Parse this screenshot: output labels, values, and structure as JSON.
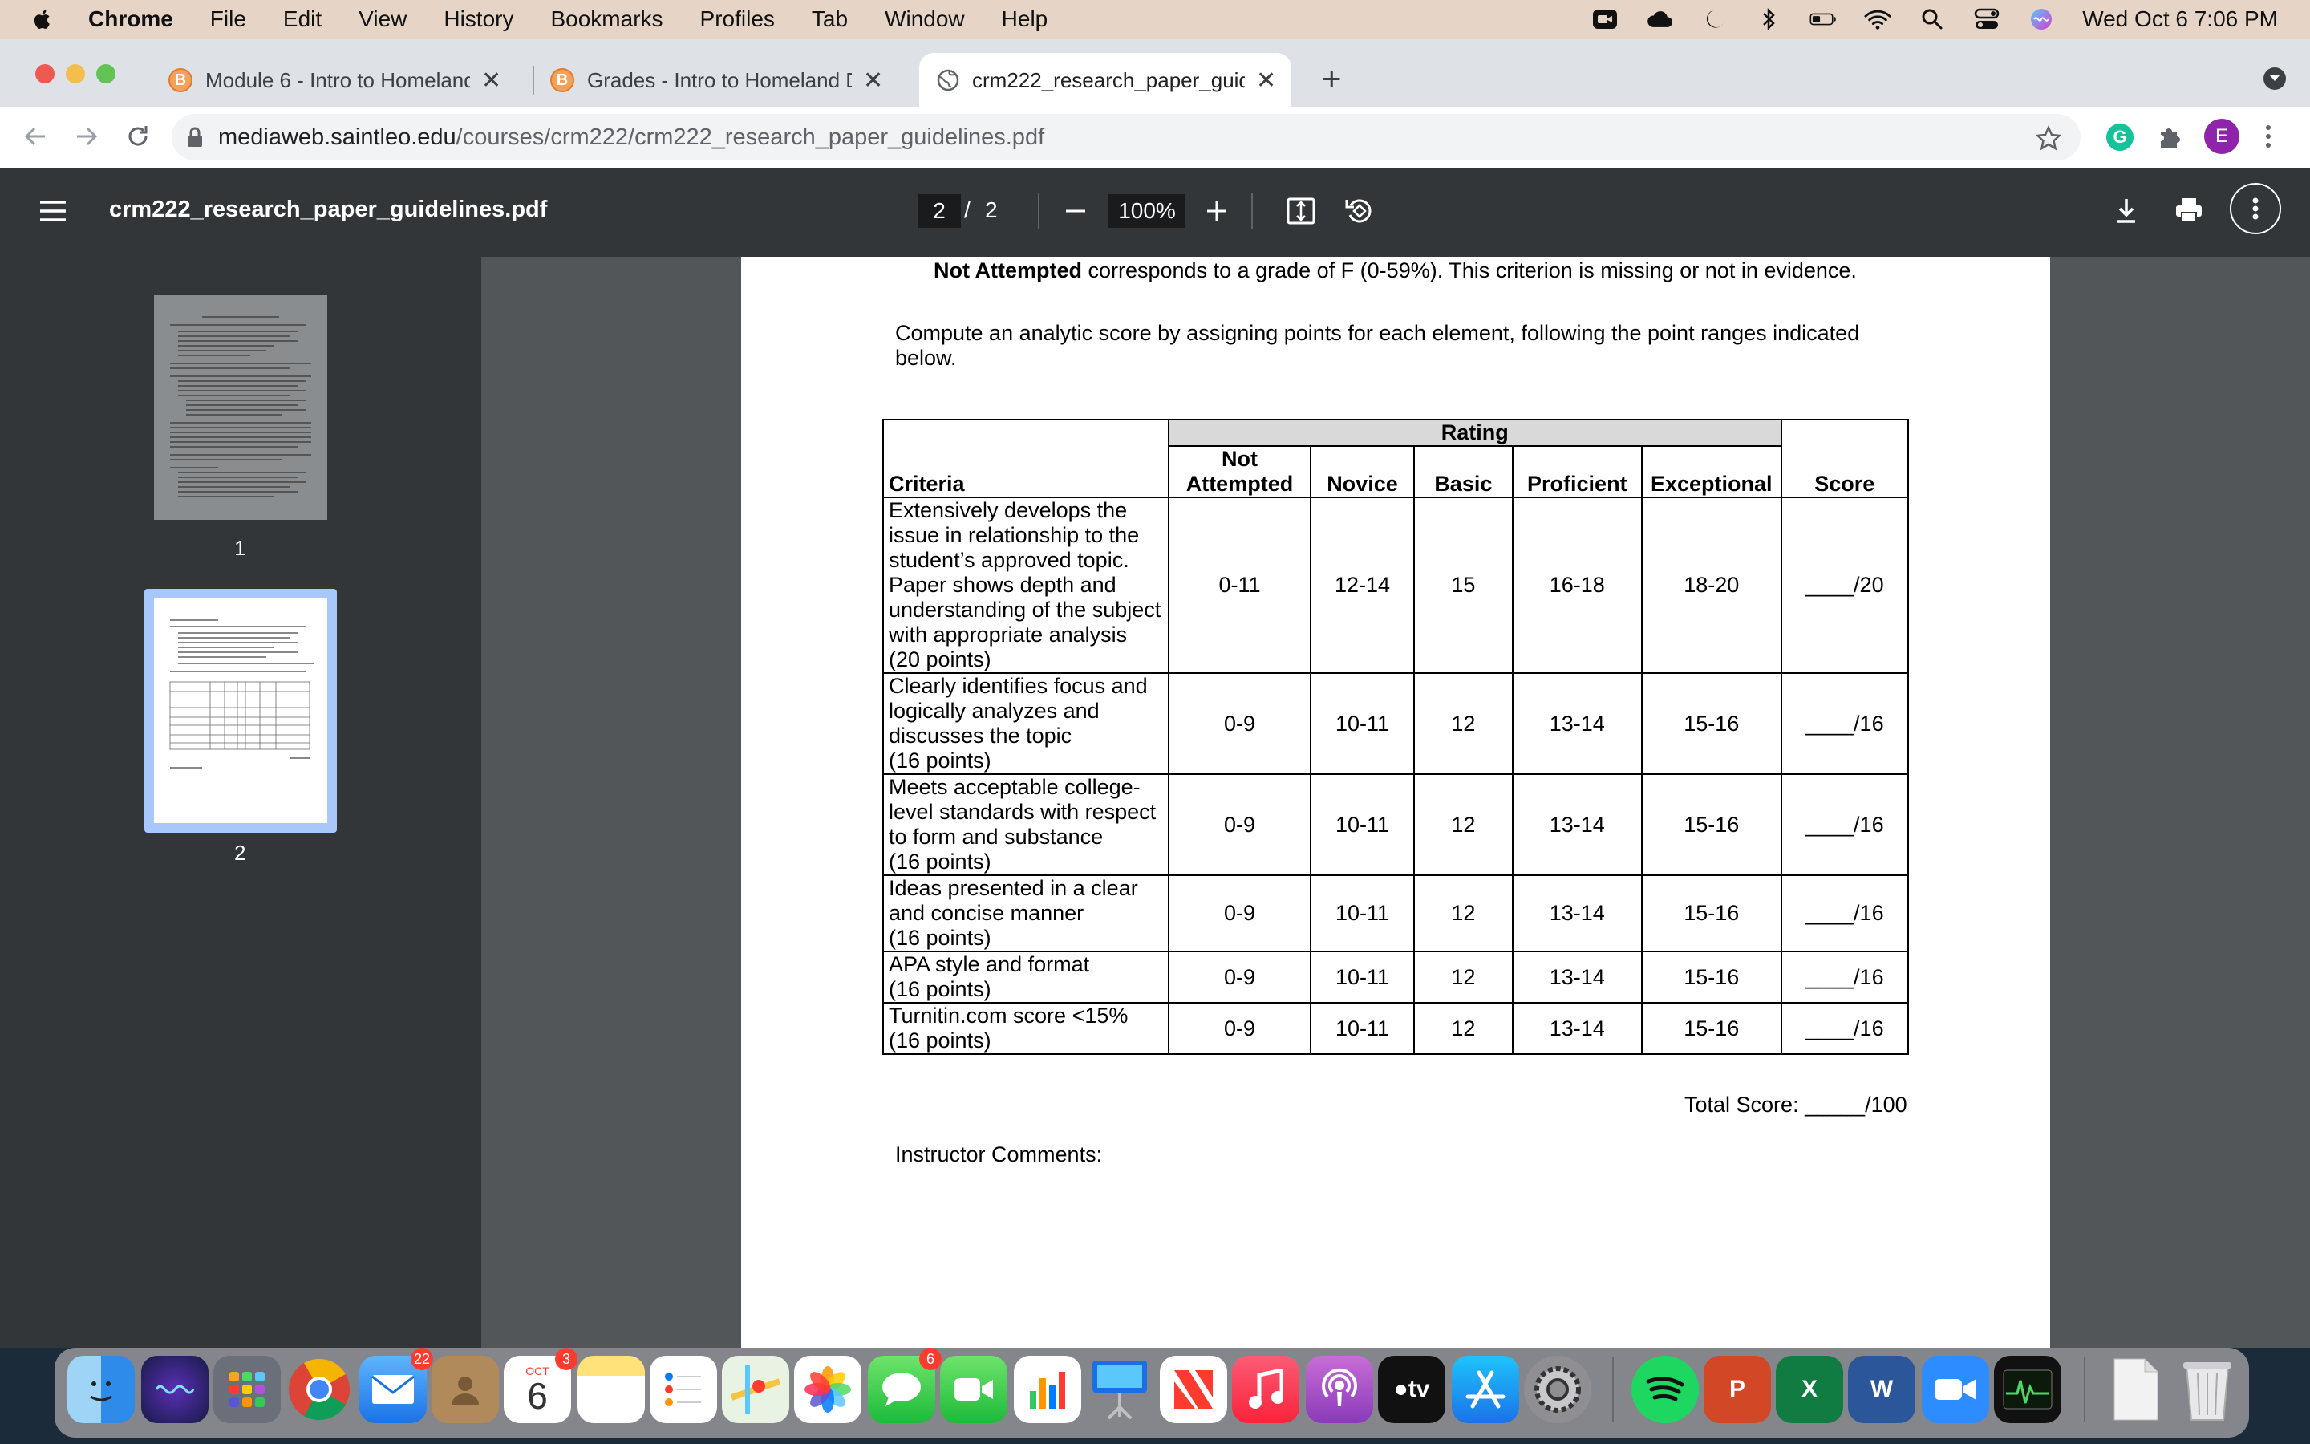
{
  "menubar": {
    "app": "Chrome",
    "items": [
      "File",
      "Edit",
      "View",
      "History",
      "Bookmarks",
      "Profiles",
      "Tab",
      "Window",
      "Help"
    ],
    "datetime": "Wed Oct 6  7:06 PM"
  },
  "tabs": [
    {
      "title": "Module 6 - Intro to Homeland D",
      "favicon": "B",
      "close": "✕"
    },
    {
      "title": "Grades - Intro to Homeland De",
      "favicon": "B",
      "close": "✕"
    },
    {
      "title": "crm222_research_paper_guide",
      "favicon": "globe-icon",
      "close": "✕"
    }
  ],
  "new_tab_label": "+",
  "address": {
    "host": "mediaweb.saintleo.edu",
    "path": "/courses/crm222/crm222_research_paper_guidelines.pdf"
  },
  "profile_initial": "E",
  "pdf": {
    "title": "crm222_research_paper_guidelines.pdf",
    "current_page": "2",
    "page_sep": "/",
    "total_pages": "2",
    "zoom": "100%",
    "thumbnails": [
      "1",
      "2"
    ]
  },
  "document": {
    "top_line_bold": "Not Attempted",
    "top_line_rest": " corresponds to a grade of F (0-59%). This criterion is missing or not in evidence.",
    "intro": "Compute an analytic score by assigning points for each element, following the point ranges indicated below.",
    "table": {
      "rating_header": "Rating",
      "headers": [
        "Criteria",
        "Not Attempted",
        "Novice",
        "Basic",
        "Proficient",
        "Exceptional",
        "Score"
      ],
      "rows": [
        {
          "criteria": "Extensively develops the issue in relationship to the student’s approved topic. Paper shows depth and understanding of the subject with appropriate analysis",
          "points": "(20 points)",
          "values": [
            "0-11",
            "12-14",
            "15",
            "16-18",
            "18-20"
          ],
          "score": "____/20"
        },
        {
          "criteria": "Clearly identifies focus and logically analyzes and discusses the topic",
          "points": "(16 points)",
          "values": [
            "0-9",
            "10-11",
            "12",
            "13-14",
            "15-16"
          ],
          "score": "____/16"
        },
        {
          "criteria": "Meets acceptable college-level standards with respect to form and substance",
          "points": "(16 points)",
          "values": [
            "0-9",
            "10-11",
            "12",
            "13-14",
            "15-16"
          ],
          "score": "____/16"
        },
        {
          "criteria": "Ideas presented in a clear and concise manner",
          "points": "(16 points)",
          "values": [
            "0-9",
            "10-11",
            "12",
            "13-14",
            "15-16"
          ],
          "score": "____/16"
        },
        {
          "criteria": "APA style and format",
          "points": "(16 points)",
          "values": [
            "0-9",
            "10-11",
            "12",
            "13-14",
            "15-16"
          ],
          "score": "____/16"
        },
        {
          "criteria": "Turnitin.com score <15%",
          "points": "(16 points)",
          "values": [
            "0-9",
            "10-11",
            "12",
            "13-14",
            "15-16"
          ],
          "score": "____/16"
        }
      ]
    },
    "total_score": "Total Score: _____/100",
    "comments_label": "Instructor Comments:"
  },
  "dock": {
    "mail_badge": "22",
    "calendar_month": "OCT",
    "calendar_day": "6",
    "calendar_badge": "3",
    "messages_badge": "6",
    "tv_label": "tv"
  }
}
